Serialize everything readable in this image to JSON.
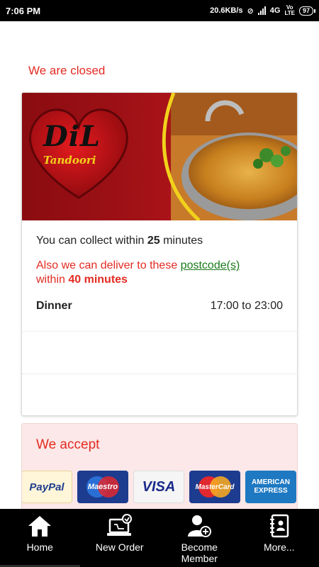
{
  "status_bar": {
    "time": "7:06 PM",
    "speed": "20.6KB/s",
    "network": "4G",
    "volte_top": "Vo",
    "volte_bottom": "LTE",
    "battery": "97"
  },
  "store_status": "We are closed",
  "banner": {
    "logo_text": "DiL",
    "logo_subtitle": "Tandoori"
  },
  "info": {
    "collect_prefix": "You can collect within ",
    "collect_minutes": "25",
    "collect_suffix": " minutes",
    "deliver_prefix": "Also we can deliver to these ",
    "deliver_link": "postcode(s)",
    "deliver_within": "within ",
    "deliver_minutes": "40 minutes",
    "hours_label": "Dinner",
    "hours_value": "17:00 to 23:00"
  },
  "accept": {
    "title": "We accept",
    "methods": [
      "PayPal",
      "Maestro",
      "VISA",
      "MasterCard",
      "AMERICAN EXPRESS"
    ]
  },
  "bottom_nav": [
    {
      "label": "Home",
      "icon": "home-icon"
    },
    {
      "label": "New Order",
      "icon": "laptop-order-icon"
    },
    {
      "label": "Become Member",
      "icon": "add-user-icon"
    },
    {
      "label": "More...",
      "icon": "contact-book-icon"
    }
  ],
  "colors": {
    "accent_red": "#e32b22",
    "link_green": "#1a7a1a",
    "nav_bg": "#000000"
  }
}
